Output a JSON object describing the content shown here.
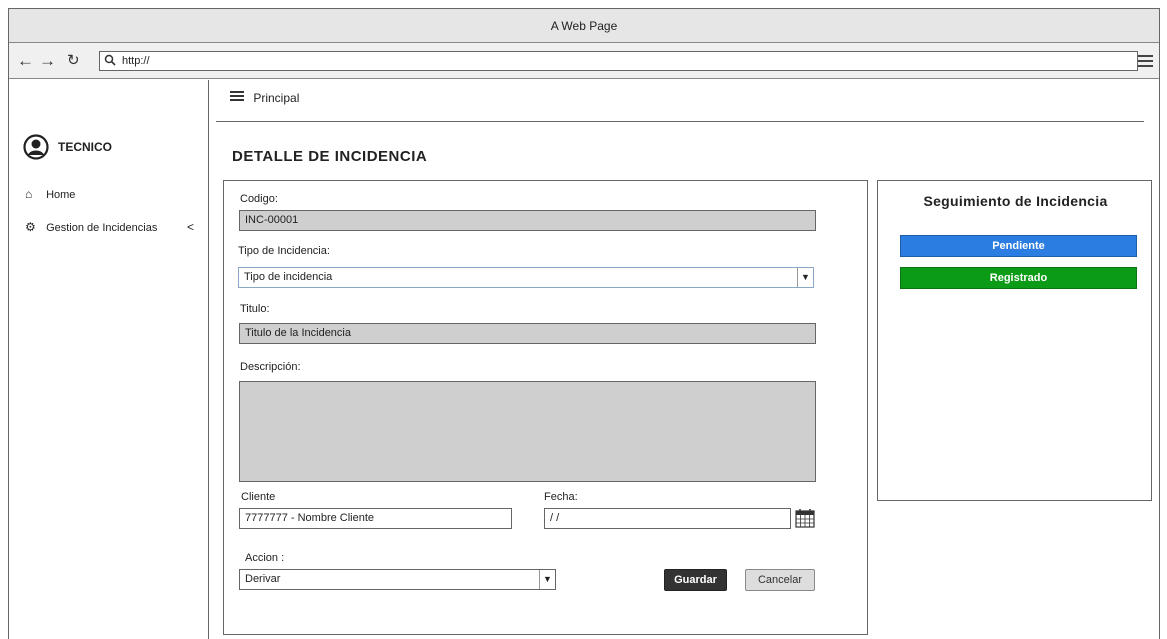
{
  "browser": {
    "title": "A Web Page",
    "url": "http://",
    "nav_icons": [
      "back-arrow-icon",
      "forward-arrow-icon",
      "reload-icon",
      "search-icon",
      "hamburger-menu-icon"
    ]
  },
  "sidebar": {
    "user_label": "TECNICO",
    "items": [
      {
        "label": "Home",
        "icon": "home-icon"
      },
      {
        "label": "Gestion de Incidencias",
        "icon": "gears-icon",
        "chevron": "<"
      }
    ]
  },
  "breadcrumb": {
    "label": "Principal",
    "icon": "list-icon"
  },
  "page_title": "DETALLE DE INCIDENCIA",
  "form": {
    "codigo_label": "Codigo:",
    "codigo_value": "INC-00001",
    "tipo_label": "Tipo de Incidencia:",
    "tipo_value": "Tipo de incidencia",
    "titulo_label": "Titulo:",
    "titulo_value": "Titulo de la Incidencia",
    "descripcion_label": "Descripción:",
    "descripcion_value": "",
    "cliente_label": "Cliente",
    "cliente_value": "7777777 - Nombre Cliente",
    "fecha_label": "Fecha:",
    "fecha_value": " /  /",
    "accion_label": "Accion :",
    "accion_value": "Derivar",
    "guardar_label": "Guardar",
    "cancelar_label": "Cancelar"
  },
  "tracking": {
    "title": "Seguimiento de Incidencia",
    "statuses": [
      {
        "label": "Pendiente",
        "color": "#2b7de1"
      },
      {
        "label": "Registrado",
        "color": "#0c9b17"
      }
    ]
  }
}
